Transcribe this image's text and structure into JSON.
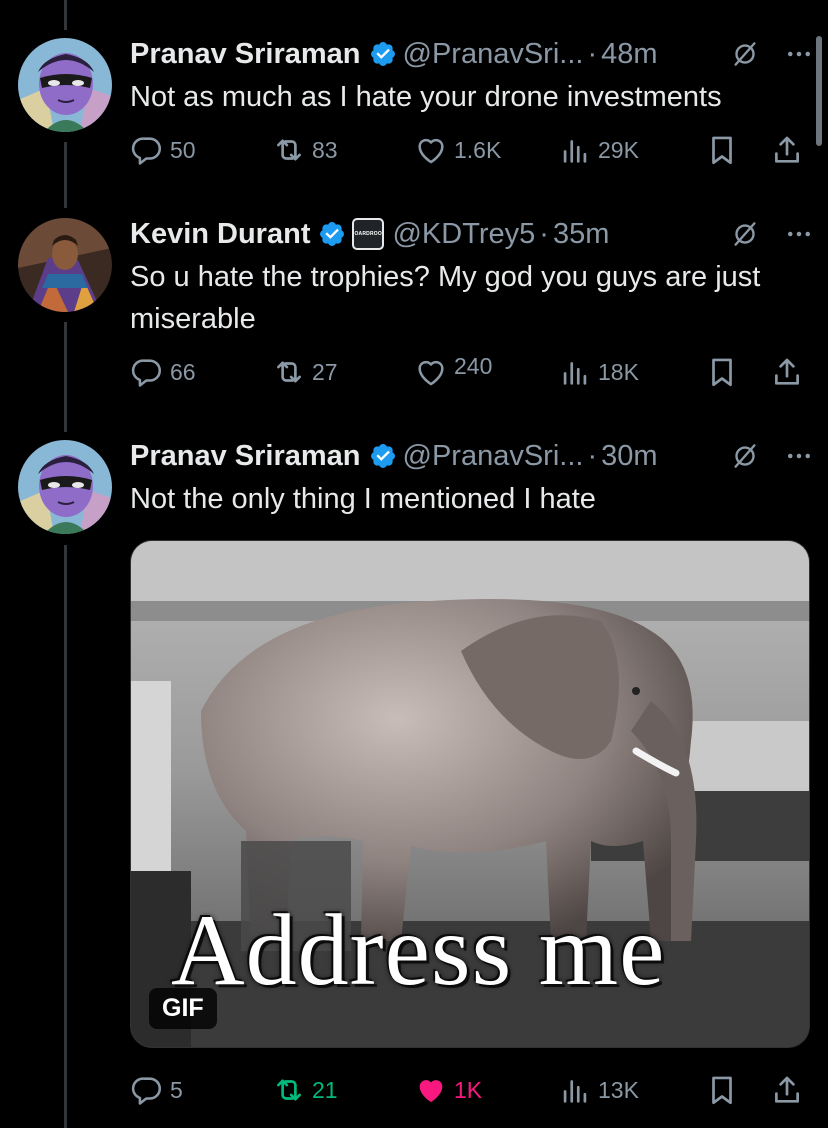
{
  "colors": {
    "background": "#000000",
    "text": "#e7e9ea",
    "secondary": "#8b98a5",
    "verified": "#1d9bf0",
    "retweet_active": "#00ba7c",
    "like_active": "#f91880",
    "thread_line": "#333639"
  },
  "tweets": [
    {
      "author": "Pranav Sriraman",
      "handle": "@PranavSri...",
      "separator": "·",
      "time": "48m",
      "text": "Not as much as I hate your drone investments",
      "replies": "50",
      "retweets": "83",
      "likes": "1.6K",
      "views": "29K",
      "icons": [
        "reply-icon",
        "retweet-icon",
        "like-icon",
        "views-icon",
        "bookmark-icon",
        "share-icon"
      ]
    },
    {
      "author": "Kevin Durant",
      "affiliate_badge": "BOARDROOM",
      "handle": "@KDTrey5",
      "separator": "·",
      "time": "35m",
      "text": "So u hate the trophies? My god you guys are just miserable",
      "replies": "66",
      "retweets": "27",
      "likes": "240",
      "views": "18K"
    },
    {
      "author": "Pranav Sriraman",
      "handle": "@PranavSri...",
      "separator": "·",
      "time": "30m",
      "text": "Not the only thing I mentioned I hate",
      "media": {
        "type": "GIF",
        "badge": "GIF",
        "caption": "Address me"
      },
      "replies": "5",
      "retweets": "21",
      "retweeted": true,
      "likes": "1K",
      "liked": true,
      "views": "13K"
    }
  ]
}
